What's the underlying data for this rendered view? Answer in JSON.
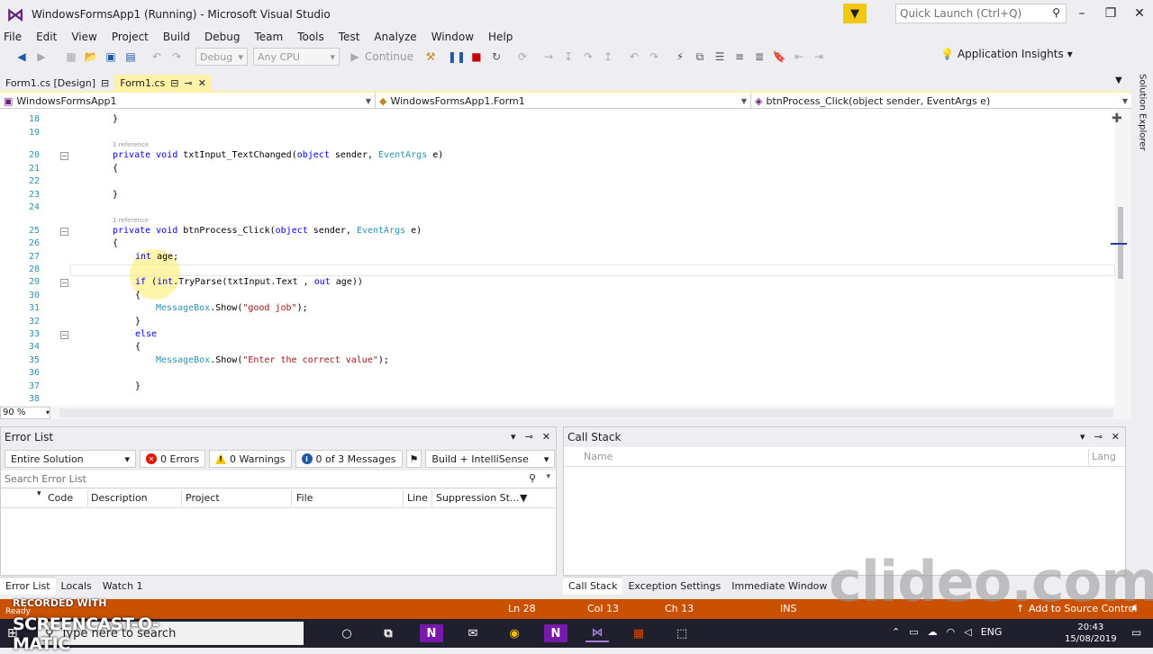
{
  "titlebar": {
    "title": "WindowsFormsApp1 (Running) - Microsoft Visual Studio",
    "quick_launch_placeholder": "Quick Launch (Ctrl+Q)"
  },
  "menu": {
    "items": [
      "File",
      "Edit",
      "View",
      "Project",
      "Build",
      "Debug",
      "Team",
      "Tools",
      "Test",
      "Analyze",
      "Window",
      "Help"
    ]
  },
  "toolbar": {
    "config": "Debug",
    "platform": "Any CPU",
    "continue_label": "Continue",
    "app_insights": "Application Insights"
  },
  "doctabs": {
    "design": "Form1.cs [Design]",
    "code": "Form1.cs"
  },
  "navbar": {
    "project": "WindowsFormsApp1",
    "class": "WindowsFormsApp1.Form1",
    "member": "btnProcess_Click(object sender, EventArgs e)"
  },
  "editor": {
    "line_numbers": [
      "18",
      "19",
      "20",
      "21",
      "22",
      "23",
      "24",
      "25",
      "26",
      "27",
      "28",
      "29",
      "30",
      "31",
      "32",
      "33",
      "34",
      "35",
      "36",
      "37",
      "38"
    ],
    "ref_label": "1 reference",
    "l18": "}",
    "l20_kw": "private void ",
    "l20_name": "txtInput_TextChanged(",
    "l20_obj": "object",
    "l20_sender": " sender, ",
    "l20_type": "EventArgs",
    "l20_end": " e)",
    "brace_open": "{",
    "brace_close": "}",
    "l25_name": "btnProcess_Click(",
    "l27_kw": "int",
    "l27_rest": " age;",
    "l29_if": "if",
    "l29_a": " (",
    "l29_int": "int",
    "l29_b": ".TryParse(txtInput.Text , ",
    "l29_out": "out",
    "l29_c": " age))",
    "msgbox": "MessageBox",
    "show": ".Show(",
    "str1": "\"good job\"",
    "end": ");",
    "else": "else",
    "str2": "\"Enter the correct value\"",
    "zoom": "90 %"
  },
  "side": {
    "solution_explorer": "Solution Explorer"
  },
  "errorlist": {
    "title": "Error List",
    "scope": "Entire Solution",
    "errors": "0 Errors",
    "warnings": "0 Warnings",
    "messages": "0 of 3 Messages",
    "build": "Build + IntelliSense",
    "search_placeholder": "Search Error List",
    "cols": [
      "Code",
      "Description",
      "Project",
      "File",
      "Line",
      "Suppression St..."
    ]
  },
  "callstack": {
    "title": "Call Stack",
    "cols": [
      "Name",
      "Lang"
    ]
  },
  "bottomtabs": {
    "left": [
      "Error List",
      "Locals",
      "Watch 1"
    ],
    "right": [
      "Call Stack",
      "Exception Settings",
      "Immediate Window"
    ]
  },
  "status": {
    "ready": "Ready",
    "ln": "Ln 28",
    "col": "Col 13",
    "ch": "Ch 13",
    "ins": "INS",
    "source_control": "Add to Source Control"
  },
  "taskbar": {
    "search_placeholder": "Type here to search",
    "lang": "ENG",
    "time": "20:43",
    "date": "15/08/2019"
  },
  "overlay": {
    "recorded_with": "RECORDED WITH",
    "screencast": "SCREENCAST-O-MATIC",
    "watermark": "clideo.com"
  }
}
